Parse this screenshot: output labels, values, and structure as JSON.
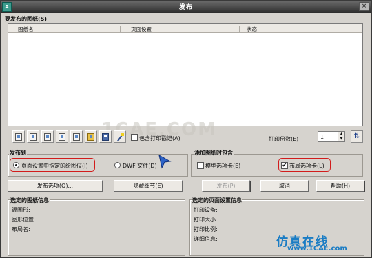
{
  "window": {
    "title": "发布",
    "close_glyph": "×",
    "app_icon_text": "A"
  },
  "sheets": {
    "label": "要发布的图纸(S)",
    "columns": [
      "图纸名",
      "页面设置",
      "状态"
    ]
  },
  "toolbar": {
    "icons": [
      "add-sheets-icon",
      "remove-sheets-icon",
      "move-up-icon",
      "move-down-icon",
      "preview-icon",
      "open-list-icon",
      "save-list-icon",
      "publish-options-icon"
    ],
    "include_stamp_label": "包含打印戳记(A)",
    "copies_label": "打印份数(E)",
    "copies_value": "1"
  },
  "publish_to": {
    "label": "发布到",
    "option_plotter": "页面设置中指定的绘图仪(I)",
    "option_dwf": "DWF 文件(D)"
  },
  "include_when_adding": {
    "label": "添加图纸时包含",
    "model_tab": "模型选项卡(E)",
    "layout_tabs": "布局选项卡(L)"
  },
  "buttons": {
    "publish_options": "发布选项(O)...",
    "hide_details": "隐藏细节(E)",
    "publish": "发布(P)",
    "cancel": "取消",
    "help": "帮助(H)"
  },
  "sheet_info": {
    "label": "选定的图纸信息",
    "rows": [
      "源图形:",
      "图形位置:",
      "布局名:"
    ]
  },
  "page_setup_info": {
    "label": "选定的页面设置信息",
    "rows": [
      "打印设备:",
      "打印大小:",
      "打印比例:",
      "详细信息:"
    ]
  },
  "watermarks": {
    "center": "1CAE.COM",
    "corner_cn": "仿真在线",
    "corner_url": "www.1CAE.com"
  },
  "colors": {
    "highlight": "#d21c1c",
    "cursor": "#2d63c8"
  }
}
